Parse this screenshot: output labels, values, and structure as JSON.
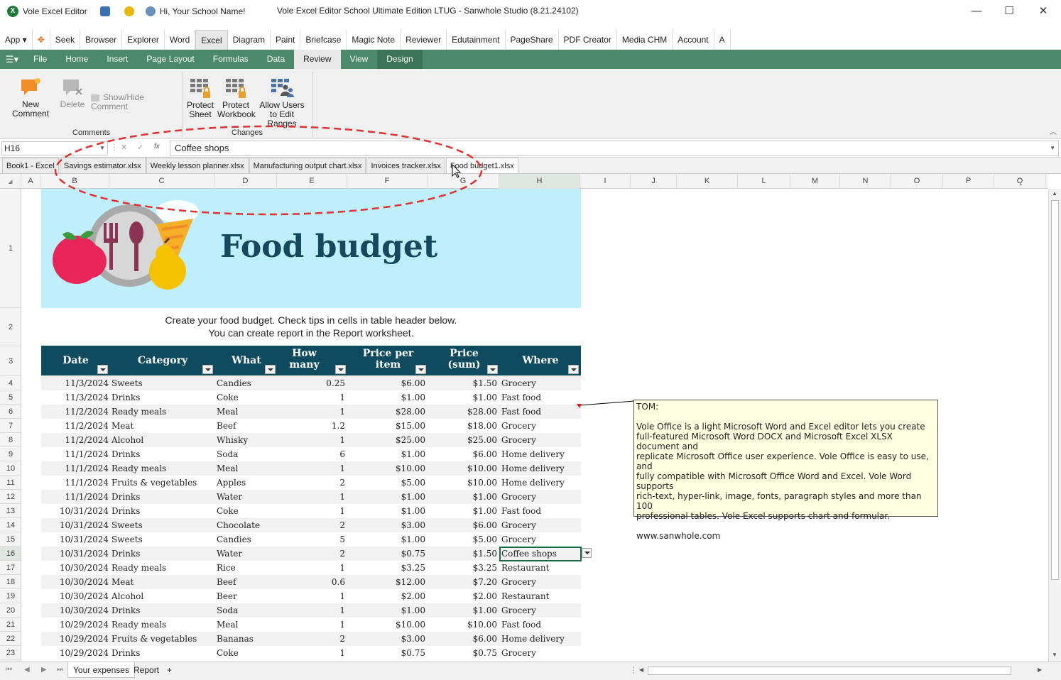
{
  "titlebar": {
    "app_name": "Vole Excel Editor",
    "greeting": "Hi, Your School Name!",
    "window_title": "Vole Excel Editor School Ultimate Edition LTUG - Sanwhole Studio (8.21.24102)",
    "minimize": "—",
    "maximize": "☐",
    "close": "✕"
  },
  "app_menu": {
    "app_label": "App ▾",
    "items": [
      "Seek",
      "Browser",
      "Explorer",
      "Word",
      "Excel",
      "Diagram",
      "Paint",
      "Briefcase",
      "Magic Note",
      "Reviewer",
      "Edutainment",
      "PageShare",
      "PDF Creator",
      "Media CHM",
      "Account",
      "A"
    ],
    "active": "Excel"
  },
  "ribbon_tabs": {
    "items": [
      "File",
      "Home",
      "Insert",
      "Page Layout",
      "Formulas",
      "Data",
      "Review",
      "View",
      "Design"
    ],
    "active": "Review"
  },
  "ribbon": {
    "new_comment": "New Comment",
    "delete": "Delete",
    "show_hide_comment": "Show/Hide Comment",
    "protect_sheet": "Protect Sheet",
    "protect_workbook": "Protect Workbook",
    "allow_users": "Allow Users to Edit Ranges",
    "group_comments": "Comments",
    "group_changes": "Changes"
  },
  "formula_bar": {
    "name_box": "H16",
    "value": "Coffee shops",
    "cancel_glyph": "✕",
    "enter_glyph": "✓",
    "fx_glyph": "fx"
  },
  "doc_tabs": {
    "items": [
      "Book1 - Excel",
      "Savings estimator.xlsx",
      "Weekly lesson planner.xlsx",
      "Manufacturing output chart.xlsx",
      "Invoices tracker.xlsx",
      "Food budget1.xlsx"
    ],
    "active": "Food budget1.xlsx"
  },
  "grid": {
    "columns": [
      "A",
      "B",
      "C",
      "D",
      "E",
      "F",
      "G",
      "H",
      "I",
      "J",
      "K",
      "L",
      "M",
      "N",
      "O",
      "P",
      "Q"
    ],
    "selected_column": "H",
    "rows": [
      "1",
      "2",
      "3",
      "4",
      "5",
      "6",
      "7",
      "8",
      "9",
      "10",
      "11",
      "12",
      "13",
      "14",
      "15",
      "16",
      "17",
      "18",
      "19",
      "20",
      "21",
      "22",
      "23"
    ],
    "selected_row": "16"
  },
  "sheet": {
    "banner_title": "Food budget",
    "subtitle_line1": "Create your food budget. Check tips in cells in table header below.",
    "subtitle_line2": "You can create report in the Report worksheet.",
    "headers": {
      "date": "Date",
      "category": "Category",
      "what": "What",
      "how_many": "How many",
      "price_per_item": "Price per item",
      "price_sum": "Price (sum)",
      "where": "Where"
    },
    "rows": [
      [
        "11/3/2024",
        "Sweets",
        "Candies",
        "0.25",
        "$6.00",
        "$1.50",
        "Grocery"
      ],
      [
        "11/3/2024",
        "Drinks",
        "Coke",
        "1",
        "$1.00",
        "$1.00",
        "Fast food"
      ],
      [
        "11/2/2024",
        "Ready meals",
        "Meal",
        "1",
        "$28.00",
        "$28.00",
        "Fast food"
      ],
      [
        "11/2/2024",
        "Meat",
        "Beef",
        "1.2",
        "$15.00",
        "$18.00",
        "Grocery"
      ],
      [
        "11/2/2024",
        "Alcohol",
        "Whisky",
        "1",
        "$25.00",
        "$25.00",
        "Grocery"
      ],
      [
        "11/1/2024",
        "Drinks",
        "Soda",
        "6",
        "$1.00",
        "$6.00",
        "Home delivery"
      ],
      [
        "11/1/2024",
        "Ready meals",
        "Meal",
        "1",
        "$10.00",
        "$10.00",
        "Home delivery"
      ],
      [
        "11/1/2024",
        "Fruits & vegetables",
        "Apples",
        "2",
        "$5.00",
        "$10.00",
        "Home delivery"
      ],
      [
        "11/1/2024",
        "Drinks",
        "Water",
        "1",
        "$1.00",
        "$1.00",
        "Grocery"
      ],
      [
        "10/31/2024",
        "Drinks",
        "Coke",
        "1",
        "$1.00",
        "$1.00",
        "Fast food"
      ],
      [
        "10/31/2024",
        "Sweets",
        "Chocolate",
        "2",
        "$3.00",
        "$6.00",
        "Grocery"
      ],
      [
        "10/31/2024",
        "Sweets",
        "Candies",
        "5",
        "$1.00",
        "$5.00",
        "Grocery"
      ],
      [
        "10/31/2024",
        "Drinks",
        "Water",
        "2",
        "$0.75",
        "$1.50",
        "Coffee shops"
      ],
      [
        "10/30/2024",
        "Ready meals",
        "Rice",
        "1",
        "$3.25",
        "$3.25",
        "Restaurant"
      ],
      [
        "10/30/2024",
        "Meat",
        "Beef",
        "0.6",
        "$12.00",
        "$7.20",
        "Grocery"
      ],
      [
        "10/30/2024",
        "Alcohol",
        "Beer",
        "1",
        "$2.00",
        "$2.00",
        "Restaurant"
      ],
      [
        "10/30/2024",
        "Drinks",
        "Soda",
        "1",
        "$1.00",
        "$1.00",
        "Grocery"
      ],
      [
        "10/29/2024",
        "Ready meals",
        "Meal",
        "1",
        "$10.00",
        "$10.00",
        "Fast food"
      ],
      [
        "10/29/2024",
        "Fruits & vegetables",
        "Bananas",
        "2",
        "$3.00",
        "$6.00",
        "Home delivery"
      ],
      [
        "10/29/2024",
        "Drinks",
        "Coke",
        "1",
        "$0.75",
        "$0.75",
        "Grocery"
      ]
    ]
  },
  "comment": {
    "author": "TOM:",
    "lines": [
      "Vole Office is a light Microsoft Word and Excel editor lets you create",
      "full-featured Microsoft Word DOCX and Microsoft Excel XLSX document and",
      "replicate Microsoft Office user experience. Vole Office is easy to use, and",
      "fully compatible with Microsoft Office Word and Excel. Vole Word supports",
      "rich-text, hyper-link, image, fonts, paragraph styles and more than 100",
      "professional tables. Vole Excel supports chart and formular."
    ],
    "url": "www.sanwhole.com"
  },
  "sheet_tabs": {
    "items": [
      "Your expenses",
      "Report"
    ],
    "active": "Your expenses",
    "add": "+"
  },
  "colors": {
    "ribbon_green": "#4a8a6a",
    "header_navy": "#0f4b5e",
    "banner_bg": "#bfeefc",
    "annotation_red": "#e03030"
  }
}
